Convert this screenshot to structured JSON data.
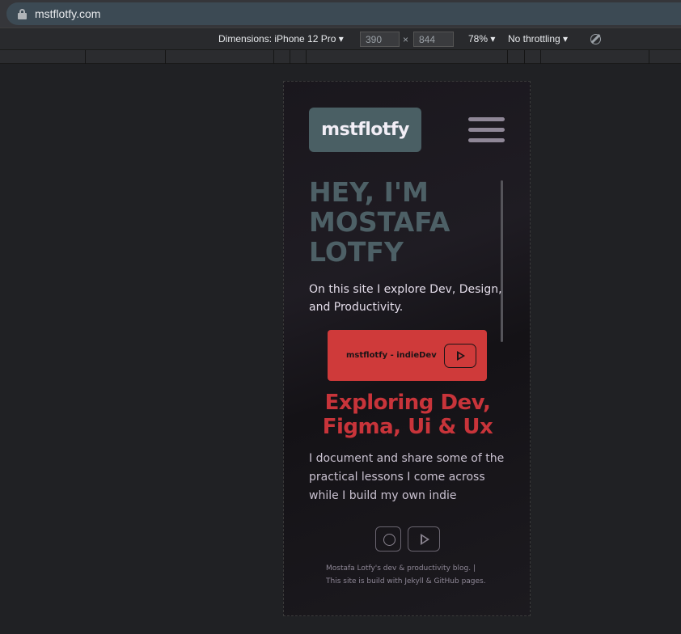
{
  "browser": {
    "url": "mstflotfy.com"
  },
  "devtools": {
    "dimensions_label": "Dimensions: iPhone 12 Pro ▾",
    "width": "390",
    "times": "×",
    "height": "844",
    "zoom": "78% ▾",
    "throttling": "No throttling ▾"
  },
  "site": {
    "logo": "mstflotfy",
    "hero_title": [
      "HEY, I'M",
      "MOSTAFA",
      "LOTFY"
    ],
    "intro": "On this site I explore Dev, Design, and Productivity.",
    "yt_button_label": "mstflotfy - indieDev",
    "headline": [
      "Exploring Dev,",
      "Figma, Ui & Ux"
    ],
    "body": "I document and share some of the practical lessons I come across while I build my own indie",
    "footer": [
      "Mostafa Lotfy's dev & productivity blog. |",
      "This site is build with Jekyll & GitHub pages."
    ]
  },
  "colors": {
    "logo_bg": "#4a5f64",
    "hero_title": "#4d6066",
    "cta_red": "#cf3a3a",
    "headline_red": "#c8343a"
  },
  "icons": [
    "lock-icon",
    "hamburger-icon",
    "youtube-play-icon",
    "instagram-icon",
    "rotate-icon"
  ]
}
